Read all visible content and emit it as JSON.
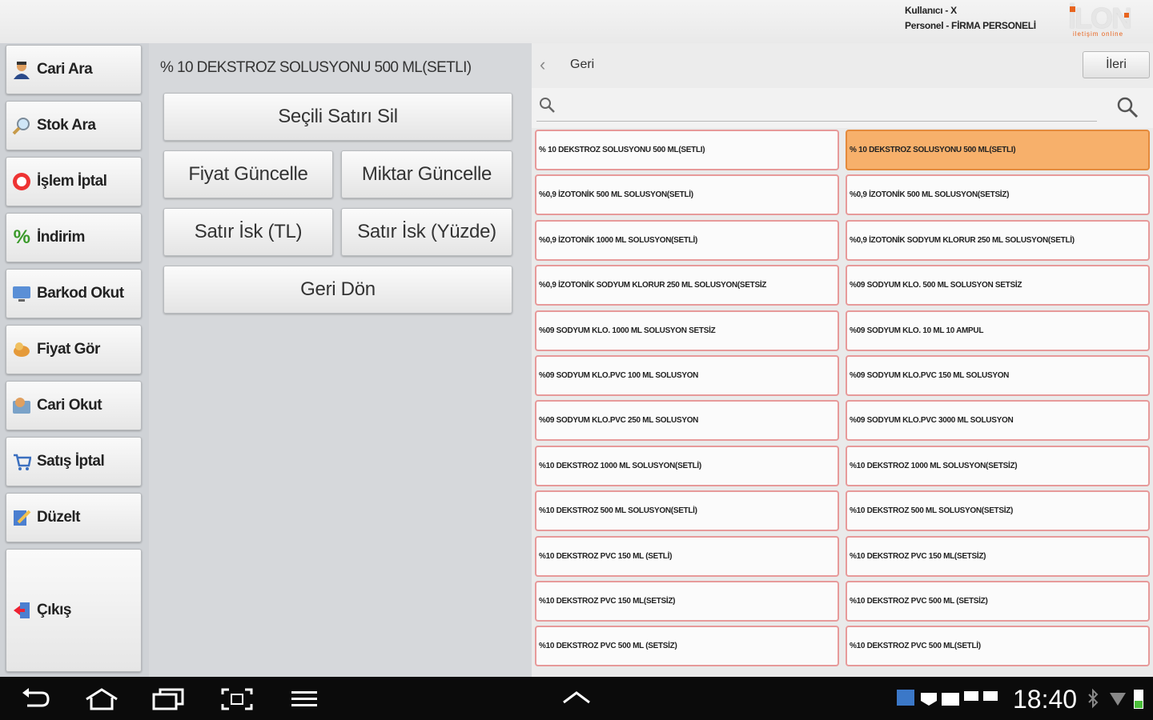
{
  "header": {
    "user_line": "Kullanıcı - X",
    "staff_line": "Personel - FİRMA PERSONELİ",
    "logo_text": "İLON",
    "logo_sub": "iletişim online"
  },
  "sidebar": {
    "items": [
      {
        "label": "Cari Ara",
        "icon": "person-icon"
      },
      {
        "label": "Stok Ara",
        "icon": "magnifier-icon"
      },
      {
        "label": "İşlem İptal",
        "icon": "cancel-icon"
      },
      {
        "label": "İndirim",
        "icon": "percent-icon"
      },
      {
        "label": "Barkod Okut",
        "icon": "monitor-icon"
      },
      {
        "label": "Fiyat Gör",
        "icon": "price-icon"
      },
      {
        "label": "Cari Okut",
        "icon": "customer-scan-icon"
      },
      {
        "label": "Satış İptal",
        "icon": "sale-cancel-icon"
      },
      {
        "label": "Düzelt",
        "icon": "edit-icon"
      },
      {
        "label": "Çıkış",
        "icon": "exit-icon"
      }
    ]
  },
  "middle": {
    "product_title": "% 10 DEKSTROZ SOLUSYONU 500 ML(SETLI)",
    "delete_row": "Seçili Satırı Sil",
    "update_price": "Fiyat Güncelle",
    "update_qty": "Miktar Güncelle",
    "row_disc_tl": "Satır İsk (TL)",
    "row_disc_pct": "Satır İsk (Yüzde)",
    "go_back": "Geri Dön"
  },
  "right": {
    "back_label": "Geri",
    "next_label": "İleri",
    "search_placeholder": "",
    "selected_index": 1,
    "products": [
      "% 10 DEKSTROZ SOLUSYONU 500 ML(SETLI)",
      "% 10 DEKSTROZ SOLUSYONU 500 ML(SETLI)",
      "%0,9 İZOTONİK 500 ML SOLUSYON(SETLİ)",
      "%0,9 İZOTONİK 500 ML SOLUSYON(SETSİZ)",
      "%0,9 İZOTONİK 1000 ML SOLUSYON(SETLİ)",
      "%0,9 İZOTONİK SODYUM KLORUR 250 ML SOLUSYON(SETLİ)",
      "%0,9 İZOTONİK SODYUM KLORUR 250 ML SOLUSYON(SETSİZ",
      "%09 SODYUM KLO. 500 ML SOLUSYON SETSİZ",
      "%09 SODYUM KLO. 1000 ML SOLUSYON SETSİZ",
      "%09 SODYUM KLO. 10 ML 10 AMPUL",
      "%09 SODYUM KLO.PVC 100 ML SOLUSYON",
      "%09 SODYUM KLO.PVC 150 ML SOLUSYON",
      "%09 SODYUM KLO.PVC 250 ML SOLUSYON",
      "%09 SODYUM KLO.PVC 3000 ML SOLUSYON",
      "%10 DEKSTROZ 1000 ML SOLUSYON(SETLİ)",
      "%10 DEKSTROZ 1000 ML SOLUSYON(SETSİZ)",
      "%10 DEKSTROZ 500 ML SOLUSYON(SETLİ)",
      "%10 DEKSTROZ 500 ML SOLUSYON(SETSİZ)",
      "%10 DEKSTROZ PVC 150 ML (SETLİ)",
      "%10 DEKSTROZ PVC 150 ML(SETSİZ)",
      "%10 DEKSTROZ PVC 150 ML(SETSİZ)",
      "%10 DEKSTROZ PVC 500 ML (SETSİZ)",
      "%10 DEKSTROZ PVC 500 ML (SETSİZ)",
      "%10 DEKSTROZ PVC 500 ML(SETLİ)"
    ]
  },
  "system_bar": {
    "time": "18:40"
  },
  "colors": {
    "selected_cell": "#f7b06b",
    "cell_border": "#e79a9a",
    "system_bar": "#0b0b0b"
  }
}
